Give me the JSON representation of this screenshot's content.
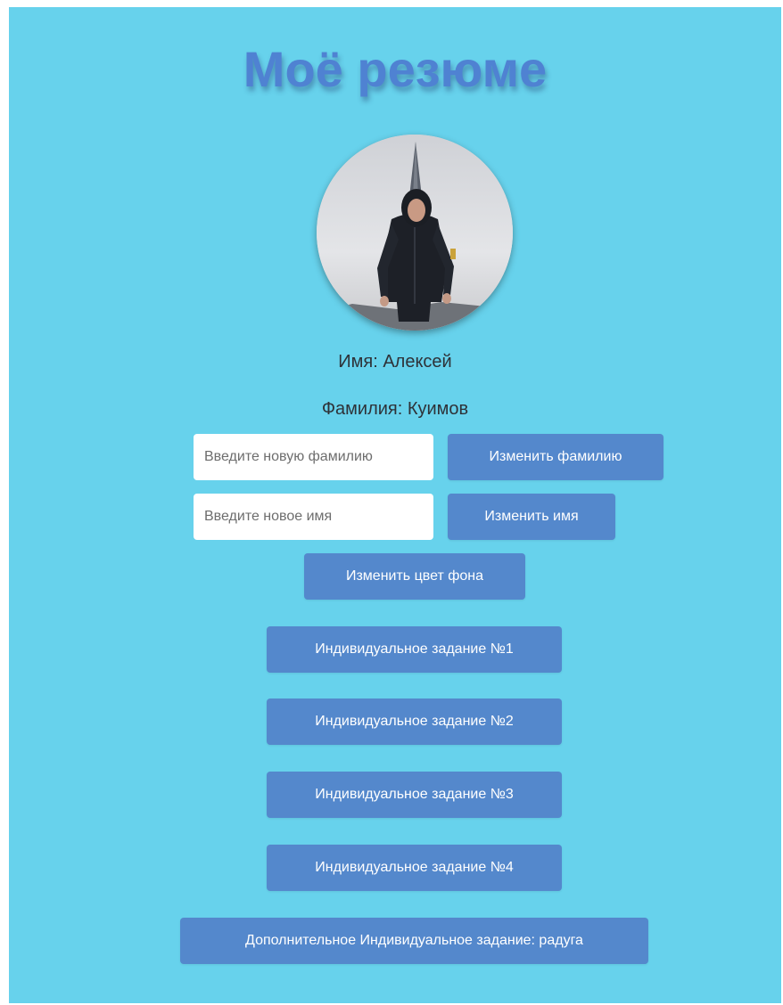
{
  "header": {
    "title": "Моё резюме"
  },
  "profile": {
    "name_line": "Имя: Алексей",
    "surname_line": "Фамилия: Куимов"
  },
  "forms": {
    "surname": {
      "placeholder": "Введите новую фамилию",
      "button_label": "Изменить фамилию"
    },
    "name": {
      "placeholder": "Введите новое имя",
      "button_label": "Изменить имя"
    }
  },
  "actions": {
    "change_bg_label": "Изменить цвет фона",
    "tasks": [
      "Индивидуальное задание №1",
      "Индивидуальное задание №2",
      "Индивидуальное задание №3",
      "Индивидуальное задание №4"
    ],
    "extra_task_label": "Дополнительное Индивидуальное задание: радуга"
  },
  "colors": {
    "page_background": "#67d2ec",
    "accent": "#5488cc",
    "title": "#4f82d2"
  }
}
